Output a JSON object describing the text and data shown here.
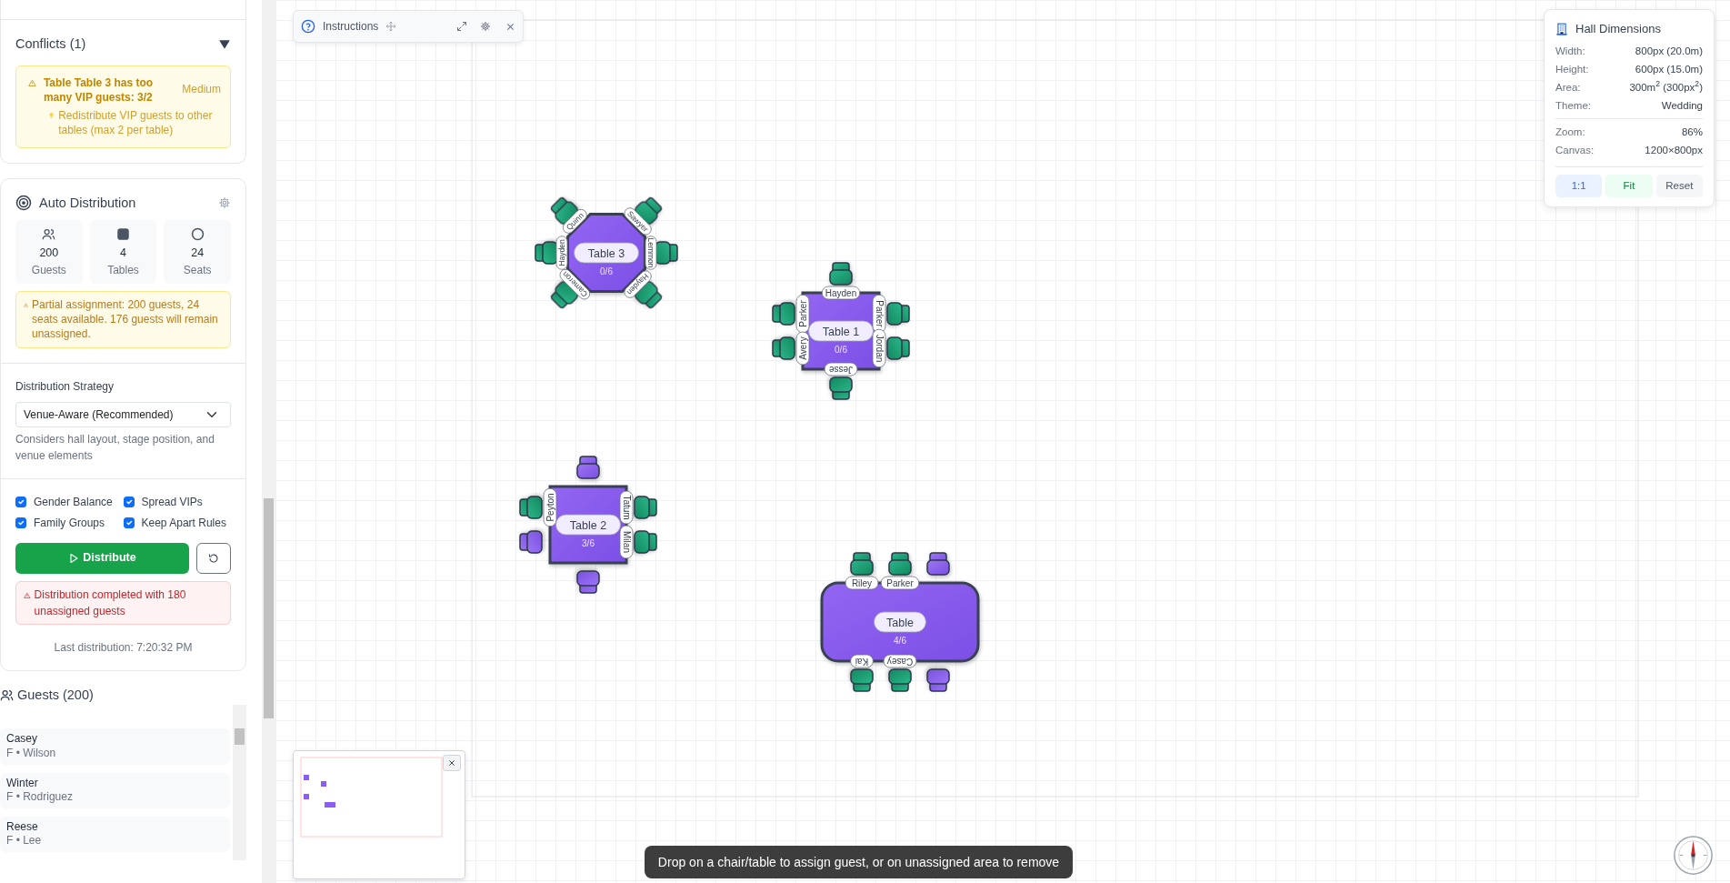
{
  "sidebar": {
    "conflicts": {
      "title": "Conflicts (1)",
      "expanded": true,
      "items": [
        {
          "message": "Table Table 3 has too many VIP guests: 3/2",
          "severity": "Medium",
          "suggestion": "Redistribute VIP guests to other tables (max 2 per table)"
        }
      ]
    },
    "auto_distribution": {
      "title": "Auto Distribution",
      "stats": [
        {
          "kind": "guests",
          "value": "200",
          "label": "Guests"
        },
        {
          "kind": "tables",
          "value": "4",
          "label": "Tables"
        },
        {
          "kind": "seats",
          "value": "24",
          "label": "Seats"
        }
      ],
      "warning": "Partial assignment: 200 guests, 24 seats available. 176 guests will remain unassigned.",
      "strategy": {
        "label": "Distribution Strategy",
        "value": "Venue-Aware (Recommended)",
        "help": "Considers hall layout, stage position, and venue elements"
      },
      "options": [
        {
          "label": "Gender Balance",
          "checked": true
        },
        {
          "label": "Spread VIPs",
          "checked": true
        },
        {
          "label": "Family Groups",
          "checked": true
        },
        {
          "label": "Keep Apart Rules",
          "checked": true
        }
      ],
      "distribute_button": "Distribute",
      "error": "Distribution completed with 180 unassigned guests",
      "last_distribution": "Last distribution: 7:20:32 PM"
    },
    "guests": {
      "title": "Guests (200)",
      "items": [
        {
          "name": "Casey",
          "detail": "F • Wilson"
        },
        {
          "name": "Winter",
          "detail": "F • Rodriguez"
        },
        {
          "name": "Reese",
          "detail": "F • Lee"
        }
      ]
    }
  },
  "canvas": {
    "instructions": {
      "title": "Instructions"
    },
    "tables": [
      {
        "name": "Table 3",
        "kind": "octagon",
        "count": "0/6",
        "seats": [
          {
            "guest": "Quinn",
            "occupied": true
          },
          {
            "guest": "Sawyer",
            "occupied": true
          },
          {
            "guest": "Lemmon",
            "occupied": true
          },
          {
            "guest": "Hayden",
            "occupied": true
          },
          {
            "guest": "Cameron",
            "occupied": true
          },
          {
            "guest": "Hayden",
            "occupied": true
          }
        ]
      },
      {
        "name": "Table 1",
        "kind": "square",
        "count": "0/6",
        "seats": [
          {
            "guest": "Hayden",
            "occupied": true
          },
          {
            "guest": "Parker",
            "occupied": true
          },
          {
            "guest": "Avery",
            "occupied": true
          },
          {
            "guest": "Parker",
            "occupied": true
          },
          {
            "guest": "Jordan",
            "occupied": true
          },
          {
            "guest": "Jesse",
            "occupied": true
          }
        ]
      },
      {
        "name": "Table 2",
        "kind": "square",
        "count": "3/6",
        "seats": [
          {
            "occupied": false
          },
          {
            "guest": "Peyton",
            "occupied": true
          },
          {
            "occupied": false
          },
          {
            "guest": "Tatum",
            "occupied": true
          },
          {
            "guest": "Milan",
            "occupied": true
          },
          {
            "occupied": false
          }
        ]
      },
      {
        "name": "Table",
        "kind": "rectangle",
        "count": "4/6",
        "seats": [
          {
            "guest": "Riley",
            "occupied": true
          },
          {
            "guest": "Parker",
            "occupied": true
          },
          {
            "occupied": false
          },
          {
            "guest": "Kai",
            "occupied": true
          },
          {
            "guest": "Casey",
            "occupied": true
          },
          {
            "occupied": false
          }
        ]
      }
    ],
    "hall_dimensions": {
      "title": "Hall Dimensions",
      "groups": [
        [
          {
            "label": "Width:",
            "value": "800px (20.0m)"
          },
          {
            "label": "Height:",
            "value": "600px (15.0m)"
          },
          {
            "label": "Area:",
            "value": "300m$^{2}$ (300px$^{2}$)"
          },
          {
            "label": "Theme:",
            "value": "Wedding"
          }
        ],
        [
          {
            "label": "Zoom:",
            "value": "86%"
          },
          {
            "label": "Canvas:",
            "value": "1200×800px"
          }
        ]
      ],
      "buttons": [
        {
          "kind": "primary",
          "label": "1:1"
        },
        {
          "kind": "success",
          "label": "Fit"
        },
        {
          "kind": "neutral",
          "label": "Reset"
        }
      ]
    },
    "toast": "Drop on a chair/table to assign guest, or on unassigned area to remove"
  }
}
